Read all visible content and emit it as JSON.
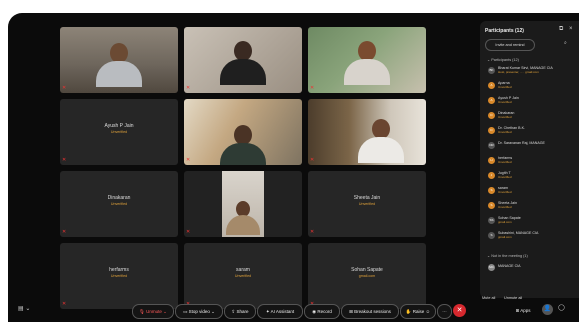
{
  "panel": {
    "title": "Participants (12)",
    "invite": "Invite and remind",
    "section_in": "Participants (12)",
    "section_out": "Not in the meeting (1)",
    "mute_all": "Mute all",
    "unmute_all": "Unmute all",
    "participants": [
      {
        "name": "Bharat Kumar Sirvi, MANAGE CIA",
        "sub": "Host, presenter, ... · gmail.com",
        "initials": "BK",
        "color": "#555"
      },
      {
        "name": "Aparna",
        "sub": "Unverified",
        "initials": "A",
        "color": "#d9892a"
      },
      {
        "name": "Ayush P Jain",
        "sub": "Unverified",
        "initials": "A",
        "color": "#d9892a"
      },
      {
        "name": "Dinakaran",
        "sub": "Unverified",
        "initials": "D",
        "color": "#d9892a"
      },
      {
        "name": "Dr. Chethan B.K.",
        "sub": "Unverified",
        "initials": "D",
        "color": "#d9892a"
      },
      {
        "name": "Dr. Saravanan Raj, MANAGE",
        "sub": "",
        "initials": "DR",
        "color": "#555"
      },
      {
        "name": "herfarms",
        "sub": "Unverified",
        "initials": "H",
        "color": "#d9892a"
      },
      {
        "name": "Jugith T",
        "sub": "Unverified",
        "initials": "J",
        "color": "#d9892a"
      },
      {
        "name": "saram",
        "sub": "Unverified",
        "initials": "S",
        "color": "#d9892a"
      },
      {
        "name": "Sheeta Jain",
        "sub": "Unverified",
        "initials": "S",
        "color": "#d9892a"
      },
      {
        "name": "Sohan Sapate",
        "sub": "gmail.com",
        "initials": "SS",
        "color": "#555"
      },
      {
        "name": "Subashini, MANAGE CIA",
        "sub": "gmail.com",
        "initials": "S",
        "color": "#555"
      }
    ],
    "not_in_meeting": [
      {
        "name": "MANAGE CIA",
        "initials": "MC",
        "color": "#888"
      }
    ]
  },
  "tiles": [
    {
      "name": "",
      "sub": ""
    },
    {
      "name": "",
      "sub": ""
    },
    {
      "name": "",
      "sub": ""
    },
    {
      "name": "Ayush P Jain",
      "sub": "Unverified"
    },
    {
      "name": "",
      "sub": ""
    },
    {
      "name": "",
      "sub": ""
    },
    {
      "name": "Dinakaran",
      "sub": "Unverified"
    },
    {
      "name": "",
      "sub": ""
    },
    {
      "name": "Sheeta Jain",
      "sub": "Unverified"
    },
    {
      "name": "herfarms",
      "sub": "Unverified"
    },
    {
      "name": "saram",
      "sub": "Unverified"
    },
    {
      "name": "Sohan Sapate",
      "sub": "gmail.com"
    }
  ],
  "toolbar": {
    "unmute": "Unmute",
    "stop_video": "Stop video",
    "share": "Share",
    "ai": "AI Assistant",
    "record": "Record",
    "breakout": "Breakout sessions",
    "raise": "Raise",
    "apps": "Apps"
  },
  "colors": {
    "accent": "#d6282e",
    "warn": "#e2a33a"
  }
}
